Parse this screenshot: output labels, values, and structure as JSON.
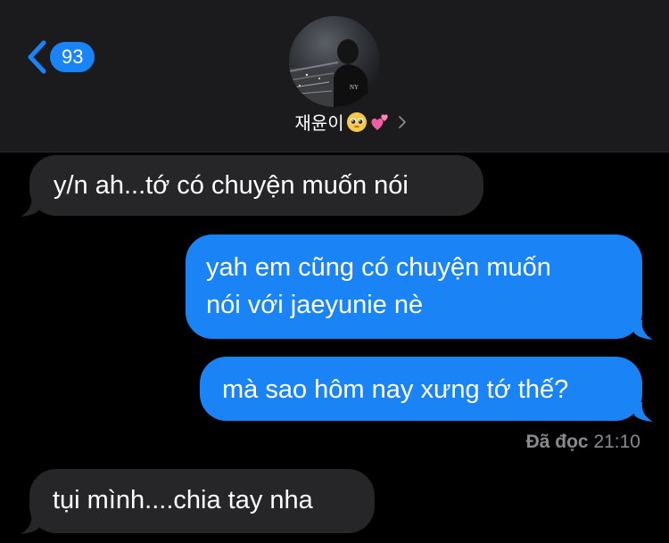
{
  "header": {
    "unread_count": "93",
    "contact_name": "재윤이",
    "contact_emojis": [
      "pleading-face",
      "two-hearts"
    ]
  },
  "messages": [
    {
      "direction": "received",
      "text": "y/n ah...tớ có chuyện muốn nói"
    },
    {
      "direction": "sent",
      "lines": [
        "yah em cũng có chuyện muốn",
        "nói với jaeyunie nè"
      ]
    },
    {
      "direction": "sent",
      "text": "mà sao hôm nay xưng tớ thế?"
    },
    {
      "direction": "received",
      "text": "tụi mình....chia tay nha"
    }
  ],
  "read_receipt": {
    "label": "Đã đọc",
    "time": "21:10"
  },
  "colors": {
    "background": "#000000",
    "header": "#1b1b1d",
    "sent_bubble": "#1a84f7",
    "received_bubble": "#262629",
    "accent": "#1a84f7"
  }
}
